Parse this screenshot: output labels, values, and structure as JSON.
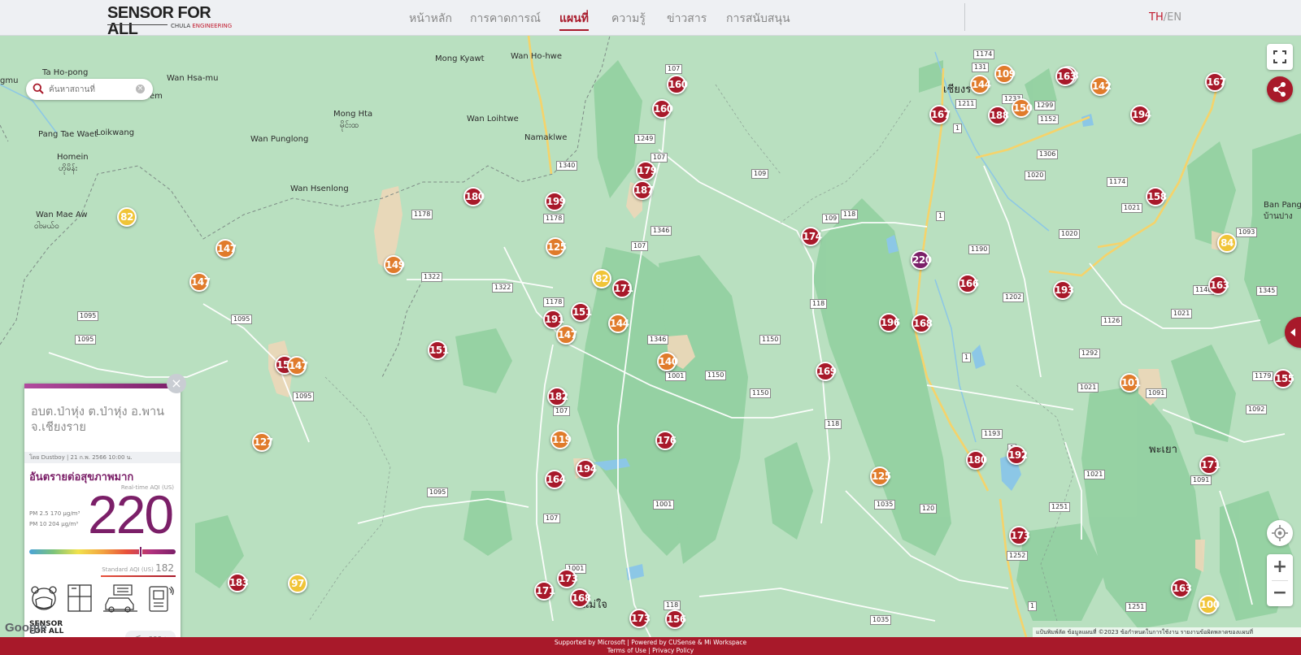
{
  "header": {
    "logo_main": "SENSOR FOR ALL",
    "logo_sub_a": "CHULA",
    "logo_sub_b": "ENGINEERING",
    "nav": [
      "หน้าหลัก",
      "การคาดการณ์",
      "แผนที่",
      "ความรู้",
      "ข่าวสาร",
      "การสนับสนุน"
    ],
    "active_nav": "แผนที่",
    "lang_th": "TH",
    "lang_sep": "/",
    "lang_en": "EN"
  },
  "search": {
    "placeholder": "ค้นหาสถานที่",
    "icon": "search-icon",
    "clear_icon": "close-icon"
  },
  "colors": {
    "brand": "#a8192a",
    "very_unhealthy": "#a8192a",
    "hazardous": "#7b1f68",
    "unhealthy_sensitive": "#e07b2b",
    "moderate": "#f0c437",
    "map_green": "#b9e0c0",
    "forest": "#8fcf9e",
    "road": "#ffffff"
  },
  "places": [
    {
      "name": "Mong Kyawt"
    },
    {
      "name": "Wan Ho-hwe"
    },
    {
      "name": "Ta Ho-pong"
    },
    {
      "name": "Wan Hsa-mu"
    },
    {
      "name": "Wan"
    },
    {
      "name": "Nawnghsem"
    },
    {
      "name": "Mong Hta"
    },
    {
      "name": "မိုင်းထ"
    },
    {
      "name": "Wan Loihtwe"
    },
    {
      "name": "Pang Tae Waet"
    },
    {
      "name": "Loikwang"
    },
    {
      "name": "Namaklwe"
    },
    {
      "name": "Wan Punglong"
    },
    {
      "name": "Homein"
    },
    {
      "name": "ဟိုမိန်း"
    },
    {
      "name": "Wan Hsenlong"
    },
    {
      "name": "Wan Mae Aw"
    },
    {
      "name": "ဝါးမယ်ဝ"
    },
    {
      "name": "Ban Pang"
    },
    {
      "name": "บ้านปาง"
    },
    {
      "name": "เชียงราย"
    },
    {
      "name": "พะเยา"
    },
    {
      "name": "แม่ใจ"
    },
    {
      "name": "gmu"
    }
  ],
  "shields": [
    {
      "label": "107"
    },
    {
      "label": "131"
    },
    {
      "label": "1174"
    },
    {
      "label": "1211"
    },
    {
      "label": "1233"
    },
    {
      "label": "1299"
    },
    {
      "label": "1152"
    },
    {
      "label": "1"
    },
    {
      "label": "1249"
    },
    {
      "label": "107"
    },
    {
      "label": "1340"
    },
    {
      "label": "109"
    },
    {
      "label": "1306"
    },
    {
      "label": "1174"
    },
    {
      "label": "1020"
    },
    {
      "label": "1178"
    },
    {
      "label": "1178"
    },
    {
      "label": "1346"
    },
    {
      "label": "109"
    },
    {
      "label": "118"
    },
    {
      "label": "1"
    },
    {
      "label": "1020"
    },
    {
      "label": "1021"
    },
    {
      "label": "1093"
    },
    {
      "label": "107"
    },
    {
      "label": "1190"
    },
    {
      "label": "1322"
    },
    {
      "label": "1322"
    },
    {
      "label": "1178"
    },
    {
      "label": "118"
    },
    {
      "label": "1202"
    },
    {
      "label": "1095"
    },
    {
      "label": "1095"
    },
    {
      "label": "1095"
    },
    {
      "label": "1150"
    },
    {
      "label": "1346"
    },
    {
      "label": "1126"
    },
    {
      "label": "1021"
    },
    {
      "label": "1148"
    },
    {
      "label": "1345"
    },
    {
      "label": "1001"
    },
    {
      "label": "1150"
    },
    {
      "label": "1292"
    },
    {
      "label": "1091"
    },
    {
      "label": "1179"
    },
    {
      "label": "1150"
    },
    {
      "label": "1"
    },
    {
      "label": "1021"
    },
    {
      "label": "1092"
    },
    {
      "label": "1095"
    },
    {
      "label": "107"
    },
    {
      "label": "118"
    },
    {
      "label": "1193"
    },
    {
      "label": "1"
    },
    {
      "label": "1021"
    },
    {
      "label": "1091"
    },
    {
      "label": "1095"
    },
    {
      "label": "1001"
    },
    {
      "label": "1035"
    },
    {
      "label": "120"
    },
    {
      "label": "1251"
    },
    {
      "label": "1252"
    },
    {
      "label": "107"
    },
    {
      "label": "1001"
    },
    {
      "label": "118"
    },
    {
      "label": "1"
    },
    {
      "label": "1035"
    },
    {
      "label": "1251"
    }
  ],
  "markers": [
    {
      "v": 160,
      "lvl": "vu"
    },
    {
      "v": 160,
      "lvl": "vu"
    },
    {
      "v": 179,
      "lvl": "vu"
    },
    {
      "v": 187,
      "lvl": "vu"
    },
    {
      "v": 180,
      "lvl": "vu"
    },
    {
      "v": 199,
      "lvl": "vu"
    },
    {
      "v": 125,
      "lvl": "us"
    },
    {
      "v": 149,
      "lvl": "us"
    },
    {
      "v": 82,
      "lvl": "m"
    },
    {
      "v": 147,
      "lvl": "us"
    },
    {
      "v": 147,
      "lvl": "us"
    },
    {
      "v": 82,
      "lvl": "m"
    },
    {
      "v": 171,
      "lvl": "vu"
    },
    {
      "v": 191,
      "lvl": "vu"
    },
    {
      "v": 151,
      "lvl": "vu"
    },
    {
      "v": 147,
      "lvl": "us"
    },
    {
      "v": 144,
      "lvl": "us"
    },
    {
      "v": 151,
      "lvl": "vu"
    },
    {
      "v": 157,
      "lvl": "vu"
    },
    {
      "v": 147,
      "lvl": "us"
    },
    {
      "v": 140,
      "lvl": "us"
    },
    {
      "v": 182,
      "lvl": "vu"
    },
    {
      "v": 119,
      "lvl": "us"
    },
    {
      "v": 176,
      "lvl": "vu"
    },
    {
      "v": 127,
      "lvl": "us"
    },
    {
      "v": 164,
      "lvl": "vu"
    },
    {
      "v": 194,
      "lvl": "vu"
    },
    {
      "v": 174,
      "lvl": "vu"
    },
    {
      "v": 220,
      "lvl": "h"
    },
    {
      "v": 166,
      "lvl": "vu"
    },
    {
      "v": 196,
      "lvl": "vu"
    },
    {
      "v": 168,
      "lvl": "vu"
    },
    {
      "v": 169,
      "lvl": "vu"
    },
    {
      "v": 125,
      "lvl": "us"
    },
    {
      "v": 167,
      "lvl": "vu"
    },
    {
      "v": 144,
      "lvl": "us"
    },
    {
      "v": 109,
      "lvl": "us"
    },
    {
      "v": 173,
      "lvl": "vu"
    },
    {
      "v": 163,
      "lvl": "vu"
    },
    {
      "v": 142,
      "lvl": "us"
    },
    {
      "v": 167,
      "lvl": "vu"
    },
    {
      "v": 188,
      "lvl": "vu"
    },
    {
      "v": 150,
      "lvl": "us"
    },
    {
      "v": 194,
      "lvl": "vu"
    },
    {
      "v": 158,
      "lvl": "vu"
    },
    {
      "v": 84,
      "lvl": "m"
    },
    {
      "v": 193,
      "lvl": "vu"
    },
    {
      "v": 163,
      "lvl": "vu"
    },
    {
      "v": 101,
      "lvl": "us"
    },
    {
      "v": 155,
      "lvl": "vu"
    },
    {
      "v": 180,
      "lvl": "vu"
    },
    {
      "v": 192,
      "lvl": "vu"
    },
    {
      "v": 171,
      "lvl": "vu"
    },
    {
      "v": 173,
      "lvl": "vu"
    },
    {
      "v": 163,
      "lvl": "vu"
    },
    {
      "v": 100,
      "lvl": "m"
    },
    {
      "v": 183,
      "lvl": "vu"
    },
    {
      "v": 97,
      "lvl": "m"
    },
    {
      "v": 171,
      "lvl": "vu"
    },
    {
      "v": 173,
      "lvl": "vu"
    },
    {
      "v": 168,
      "lvl": "vu"
    },
    {
      "v": 173,
      "lvl": "vu"
    },
    {
      "v": 156,
      "lvl": "vu"
    }
  ],
  "controls": {
    "fullscreen_icon": "fullscreen-icon",
    "share_icon": "share-icon",
    "panel_toggle_icon": "chevron-left-icon",
    "locate_icon": "locate-icon",
    "zoom_in": "+",
    "zoom_out": "−"
  },
  "station_card": {
    "name": "อบต.ป่าหุ่ง ต.ป่าหุ่ง อ.พาน จ.เชียงราย",
    "source": "โดย Dustboy | 21 ก.พ. 2566 10:00 น.",
    "level_text": "อันตรายต่อสุขภาพมาก",
    "realtime_label": "Real-time AQI (US)",
    "aqi": "220",
    "pm25": "PM 2.5 170 µg/m³",
    "pm10": "PM 10  204 µg/m³",
    "aqi_fraction": 0.75,
    "standard_label": "Standard AQI (US)",
    "standard_value": "182",
    "footer_dots": "ooo",
    "logo_a": "SENSOR",
    "logo_b": "FOR ALL",
    "icons": [
      "mask-icon",
      "window-icon",
      "car-air-icon",
      "air-purifier-icon"
    ]
  },
  "google_logo": "Google",
  "attribution": "แป้นพิมพ์ลัด   ข้อมูลแผนที่ ©2023   ข้อกำหนดในการใช้งาน   รายงานข้อผิดพลาดของแผนที่",
  "footer": {
    "line1": "Supported by Microsoft | Powered by CUSense & Mi Workspace",
    "line2": "Terms of Use | Privacy Policy"
  }
}
